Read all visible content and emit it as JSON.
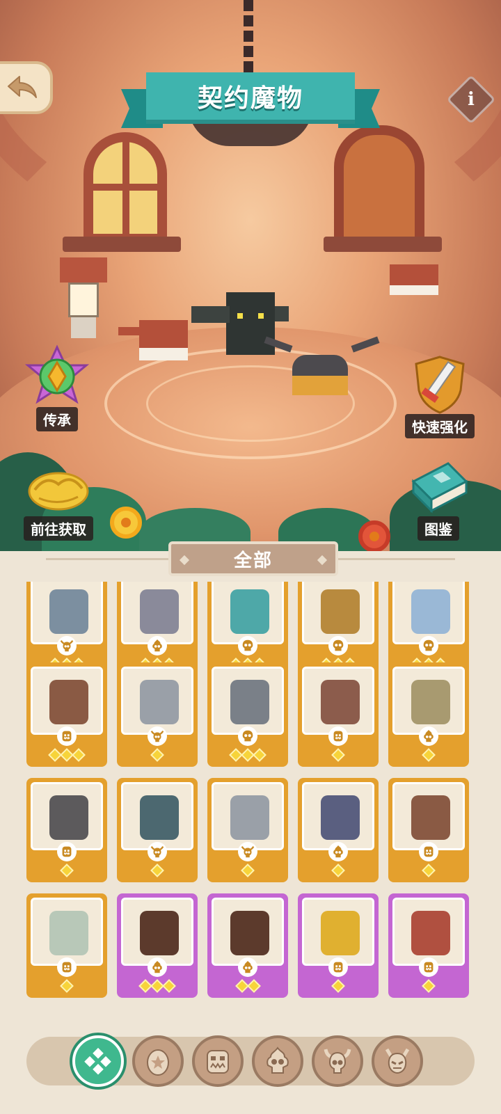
{
  "header": {
    "title": "契约魔物",
    "back_icon": "back-arrow-icon",
    "info_label": "i"
  },
  "actions": {
    "inherit": "传承",
    "quick_upgrade": "快速强化",
    "go_obtain": "前往获取",
    "codex": "图鉴"
  },
  "filter": {
    "label": "全部"
  },
  "monsters": [
    {
      "type": "horn-skull",
      "stars": 3,
      "rarity": "gold"
    },
    {
      "type": "flame-skull",
      "stars": 3,
      "rarity": "gold"
    },
    {
      "type": "skull",
      "stars": 3,
      "rarity": "gold"
    },
    {
      "type": "skull",
      "stars": 3,
      "rarity": "gold"
    },
    {
      "type": "skull",
      "stars": 3,
      "rarity": "gold"
    },
    {
      "type": "ogre",
      "stars": 3,
      "rarity": "gold"
    },
    {
      "type": "horn-skull",
      "stars": 1,
      "rarity": "gold"
    },
    {
      "type": "skull",
      "stars": 3,
      "rarity": "gold"
    },
    {
      "type": "ogre",
      "stars": 1,
      "rarity": "gold"
    },
    {
      "type": "flame-skull",
      "stars": 1,
      "rarity": "gold"
    },
    {
      "type": "ogre",
      "stars": 1,
      "rarity": "gold"
    },
    {
      "type": "horn-skull",
      "stars": 1,
      "rarity": "gold"
    },
    {
      "type": "horn-skull",
      "stars": 1,
      "rarity": "gold"
    },
    {
      "type": "flame-skull",
      "stars": 1,
      "rarity": "gold"
    },
    {
      "type": "ogre",
      "stars": 1,
      "rarity": "gold"
    },
    {
      "type": "ogre",
      "stars": 1,
      "rarity": "gold"
    },
    {
      "type": "flame-skull",
      "stars": 3,
      "rarity": "epic"
    },
    {
      "type": "flame-skull",
      "stars": 2,
      "rarity": "epic"
    },
    {
      "type": "ogre",
      "stars": 1,
      "rarity": "epic"
    },
    {
      "type": "ogre",
      "stars": 1,
      "rarity": "epic"
    }
  ],
  "tabs": [
    {
      "name": "all-tab",
      "icon": "clover-icon",
      "active": true
    },
    {
      "name": "egg-tab",
      "icon": "egg-star-icon",
      "active": false
    },
    {
      "name": "ogre-tab",
      "icon": "ogre-face-icon",
      "active": false
    },
    {
      "name": "flame-skull-tab",
      "icon": "flame-skull-icon",
      "active": false
    },
    {
      "name": "horn-skull-tab",
      "icon": "horned-skull-icon",
      "active": false
    },
    {
      "name": "demon-tab",
      "icon": "demon-face-icon",
      "active": false
    }
  ],
  "colors": {
    "teal_banner": "#3fb4ae",
    "gold_card": "#e4a02d",
    "epic_card": "#c466d2",
    "active_tab": "#3fb88e"
  }
}
